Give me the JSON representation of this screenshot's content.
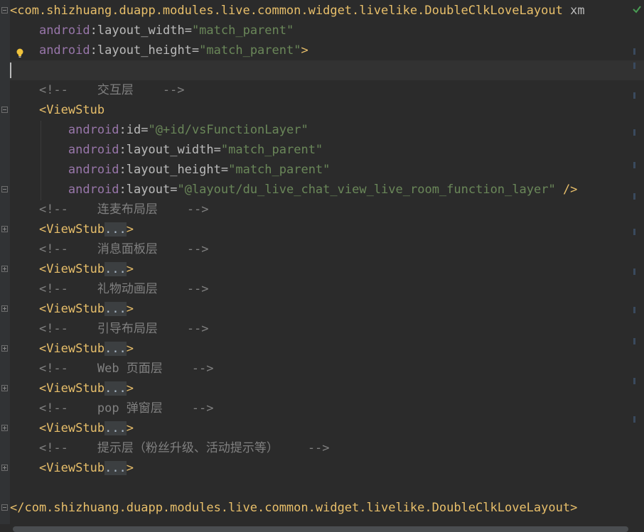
{
  "icons": {
    "inspection_ok": "check-icon",
    "intention": "lightbulb-icon"
  },
  "colors": {
    "background": "#2b2b2b",
    "tag": "#e8bf6a",
    "namespace": "#9876aa",
    "attribute": "#bababa",
    "value": "#6a8759",
    "comment": "#808080",
    "check": "#499c54"
  },
  "lines": {
    "l1": {
      "tag": "<com.shizhuang.duapp.modules.live.common.widget.livelike.DoubleClkLoveLayout",
      "ns_decl": "xm"
    },
    "l2": {
      "ns": "android",
      "colon": ":",
      "attr": "layout_width",
      "eq": "=",
      "value": "\"match_parent\""
    },
    "l3": {
      "ns": "android",
      "colon": ":",
      "attr": "layout_height",
      "eq": "=",
      "value": "\"match_parent\"",
      "close": ">"
    },
    "l5": {
      "open": "<!--",
      "text": "交互层",
      "close": "-->"
    },
    "l6": {
      "tag": "<ViewStub"
    },
    "l7": {
      "ns": "android",
      "colon": ":",
      "attr": "id",
      "eq": "=",
      "value": "\"@+id/vsFunctionLayer\""
    },
    "l8": {
      "ns": "android",
      "colon": ":",
      "attr": "layout_width",
      "eq": "=",
      "value": "\"match_parent\""
    },
    "l9": {
      "ns": "android",
      "colon": ":",
      "attr": "layout_height",
      "eq": "=",
      "value": "\"match_parent\""
    },
    "l10": {
      "ns": "android",
      "colon": ":",
      "attr": "layout",
      "eq": "=",
      "value": "\"@layout/du_live_chat_view_live_room_function_layer\"",
      "close": "/>"
    },
    "l11": {
      "open": "<!--",
      "text": "连麦布局层",
      "close": "-->"
    },
    "l12": {
      "tag": "<ViewStub",
      "dots": "...",
      "close": ">"
    },
    "l13": {
      "open": "<!--",
      "text": "消息面板层",
      "close": "-->"
    },
    "l14": {
      "tag": "<ViewStub",
      "dots": "...",
      "close": ">"
    },
    "l15": {
      "open": "<!--",
      "text": "礼物动画层",
      "close": "-->"
    },
    "l16": {
      "tag": "<ViewStub",
      "dots": "...",
      "close": ">"
    },
    "l17": {
      "open": "<!--",
      "text": "引导布局层",
      "close": "-->"
    },
    "l18": {
      "tag": "<ViewStub",
      "dots": "...",
      "close": ">"
    },
    "l19": {
      "open": "<!--",
      "text": "Web 页面层",
      "close": "-->"
    },
    "l20": {
      "tag": "<ViewStub",
      "dots": "...",
      "close": ">"
    },
    "l21": {
      "open": "<!--",
      "text": "pop 弹窗层",
      "close": "-->"
    },
    "l22": {
      "tag": "<ViewStub",
      "dots": "...",
      "close": ">"
    },
    "l23": {
      "open": "<!--",
      "text": "提示层（粉丝升级、活动提示等）",
      "close": "-->"
    },
    "l24": {
      "tag": "<ViewStub",
      "dots": "...",
      "close": ">"
    },
    "l26": {
      "tag": "</com.shizhuang.duapp.modules.live.common.widget.livelike.DoubleClkLoveLayout>"
    }
  }
}
